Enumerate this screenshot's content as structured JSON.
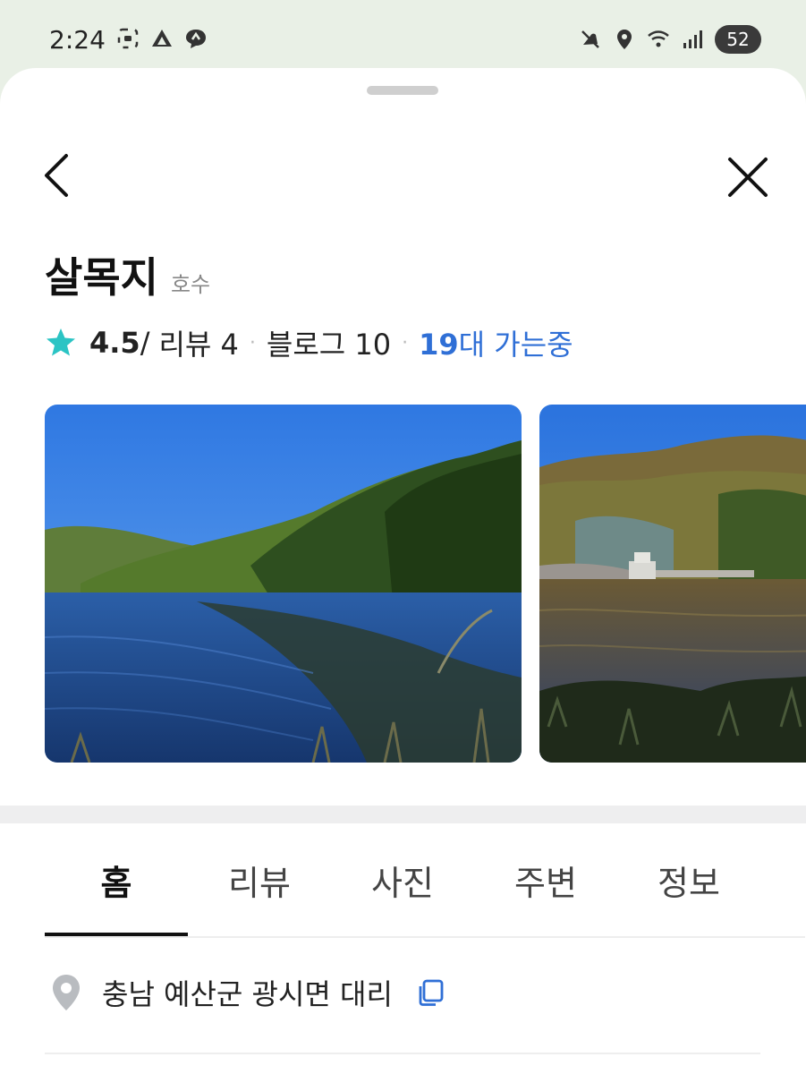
{
  "status_bar": {
    "time": "2:24",
    "battery": "52",
    "left_icons": [
      "screenshot-icon",
      "app-icon",
      "chat-icon"
    ],
    "right_icons": [
      "mute-icon",
      "location-icon",
      "wifi-icon",
      "signal-icon"
    ]
  },
  "header": {
    "back_icon": "chevron-left-icon",
    "close_icon": "close-icon"
  },
  "place": {
    "name": "살목지",
    "category": "호수",
    "rating": "4.5",
    "rating_suffix": "/",
    "reviews_label": "리뷰 4",
    "blog_label": "블로그 10",
    "going_count": "19",
    "going_text": "대 가는중"
  },
  "photos": [
    "lake-photo-1",
    "lake-photo-2"
  ],
  "tabs": [
    {
      "label": "홈",
      "active": true
    },
    {
      "label": "리뷰",
      "active": false
    },
    {
      "label": "사진",
      "active": false
    },
    {
      "label": "주변",
      "active": false
    },
    {
      "label": "정보",
      "active": false
    }
  ],
  "address": {
    "text": "충남 예산군 광시면 대리"
  },
  "colors": {
    "accent_blue": "#2f6fd6",
    "star": "#2bc4c4",
    "status_bg": "#e9f0e6"
  }
}
